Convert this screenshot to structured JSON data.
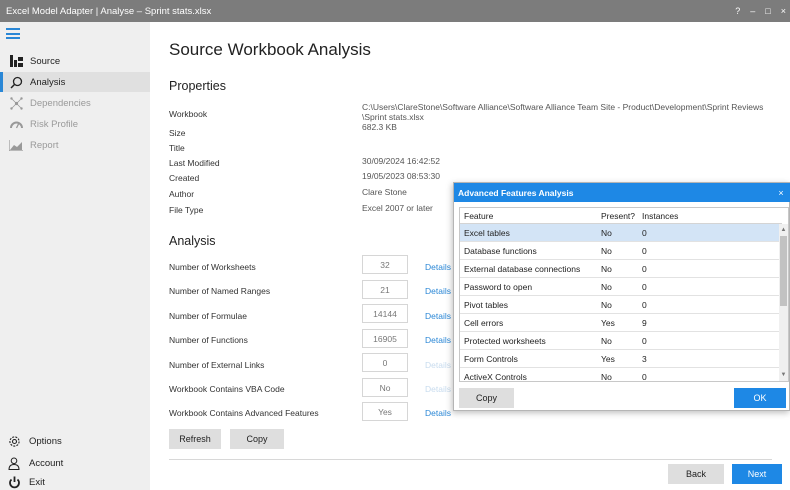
{
  "window": {
    "title": "Excel Model Adapter | Analyse – Sprint stats.xlsx",
    "controls": [
      "?",
      "–",
      "□",
      "×"
    ]
  },
  "sidebar": {
    "items": [
      {
        "label": "Source",
        "icon": "source-icon",
        "state": "enabled"
      },
      {
        "label": "Analysis",
        "icon": "search-icon",
        "state": "active"
      },
      {
        "label": "Dependencies",
        "icon": "dependencies-icon",
        "state": "disabled"
      },
      {
        "label": "Risk Profile",
        "icon": "gauge-icon",
        "state": "disabled"
      },
      {
        "label": "Report",
        "icon": "chart-icon",
        "state": "disabled"
      }
    ],
    "bottom": [
      {
        "label": "Options",
        "icon": "gear-icon"
      },
      {
        "label": "Account",
        "icon": "user-icon"
      },
      {
        "label": "Exit",
        "icon": "power-icon"
      }
    ]
  },
  "main": {
    "title": "Source Workbook Analysis",
    "properties_heading": "Properties",
    "properties": [
      {
        "label": "Workbook",
        "value": "C:\\Users\\ClareStone\\Software Alliance\\Software Alliance Team Site - Product\\Development\\Sprint Reviews\n\\Sprint stats.xlsx"
      },
      {
        "label": "Size",
        "value": "682.3 KB"
      },
      {
        "label": "Title",
        "value": ""
      },
      {
        "label": "Last Modified",
        "value": "30/09/2024 16:42:52"
      },
      {
        "label": "Created",
        "value": "19/05/2023 08:53:30"
      },
      {
        "label": "Author",
        "value": "Clare Stone"
      },
      {
        "label": "File Type",
        "value": "Excel 2007 or later"
      }
    ],
    "analysis_heading": "Analysis",
    "analysis": [
      {
        "label": "Number of Worksheets",
        "value": "32",
        "link": "Details",
        "link_enabled": true
      },
      {
        "label": "Number of Named Ranges",
        "value": "21",
        "link": "Details",
        "link_enabled": true
      },
      {
        "label": "Number of Formulae",
        "value": "14144",
        "link": "Details",
        "link_enabled": true
      },
      {
        "label": "Number of Functions",
        "value": "16905",
        "link": "Details",
        "link_enabled": true
      },
      {
        "label": "Number of External Links",
        "value": "0",
        "link": "Details",
        "link_enabled": false
      },
      {
        "label": "Workbook Contains VBA Code",
        "value": "No",
        "link": "Details",
        "link_enabled": false
      },
      {
        "label": "Workbook Contains Advanced Features",
        "value": "Yes",
        "link": "Details",
        "link_enabled": true
      }
    ],
    "refresh_label": "Refresh",
    "copy_label": "Copy",
    "back_label": "Back",
    "next_label": "Next"
  },
  "dialog": {
    "title": "Advanced Features Analysis",
    "close": "×",
    "columns": [
      "Feature",
      "Present?",
      "Instances"
    ],
    "rows": [
      {
        "feature": "Excel tables",
        "present": "No",
        "instances": "0",
        "selected": true
      },
      {
        "feature": "Database functions",
        "present": "No",
        "instances": "0"
      },
      {
        "feature": "External database connections",
        "present": "No",
        "instances": "0"
      },
      {
        "feature": "Password to open",
        "present": "No",
        "instances": "0"
      },
      {
        "feature": "Pivot tables",
        "present": "No",
        "instances": "0"
      },
      {
        "feature": "Cell errors",
        "present": "Yes",
        "instances": "9"
      },
      {
        "feature": "Protected worksheets",
        "present": "No",
        "instances": "0"
      },
      {
        "feature": "Form Controls",
        "present": "Yes",
        "instances": "3"
      },
      {
        "feature": "ActiveX Controls",
        "present": "No",
        "instances": "0"
      }
    ],
    "copy_label": "Copy",
    "ok_label": "OK"
  },
  "colors": {
    "accent": "#1e88e5",
    "title_bar": "#7c7c7c",
    "sidebar": "#efefef"
  }
}
